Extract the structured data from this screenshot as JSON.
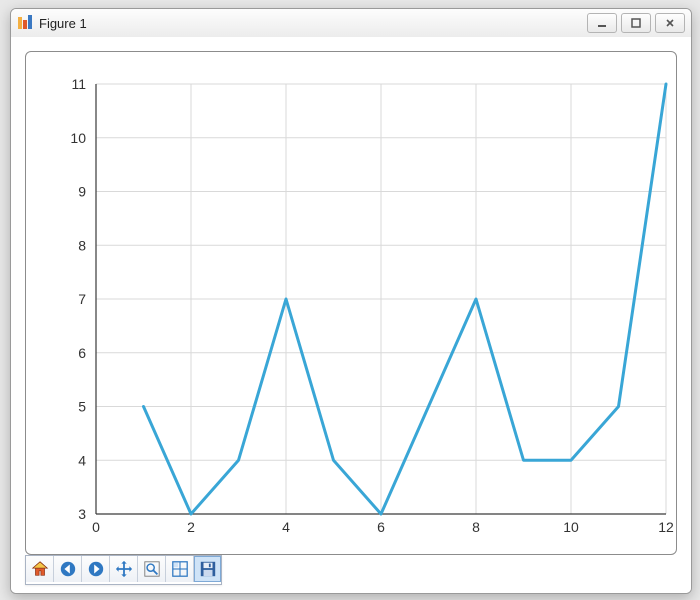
{
  "window": {
    "title": "Figure 1",
    "controls": {
      "minimize_tooltip": "Minimize",
      "maximize_tooltip": "Maximize",
      "close_tooltip": "Close"
    }
  },
  "toolbar": {
    "items": [
      {
        "id": "home",
        "label": "Home"
      },
      {
        "id": "back",
        "label": "Back"
      },
      {
        "id": "forward",
        "label": "Forward"
      },
      {
        "id": "pan",
        "label": "Pan"
      },
      {
        "id": "zoom",
        "label": "Zoom"
      },
      {
        "id": "subplots",
        "label": "Configure subplots"
      },
      {
        "id": "save",
        "label": "Save"
      }
    ]
  },
  "colors": {
    "series": "#39a6d6",
    "grid": "#d9d9d9",
    "axis": "#3a3a3a"
  },
  "chart_data": {
    "type": "line",
    "title": "",
    "xlabel": "",
    "ylabel": "",
    "x": [
      1,
      2,
      3,
      4,
      5,
      6,
      7,
      8,
      9,
      10,
      11,
      12
    ],
    "series": [
      {
        "name": "",
        "values": [
          5,
          3,
          4,
          7,
          4,
          3,
          5,
          7,
          4,
          4,
          5,
          11
        ]
      }
    ],
    "x_ticks": [
      0,
      2,
      4,
      6,
      8,
      10,
      12
    ],
    "y_ticks": [
      3,
      4,
      5,
      6,
      7,
      8,
      9,
      10,
      11
    ],
    "xlim": [
      0,
      12
    ],
    "ylim": [
      3,
      11
    ],
    "grid": true
  }
}
